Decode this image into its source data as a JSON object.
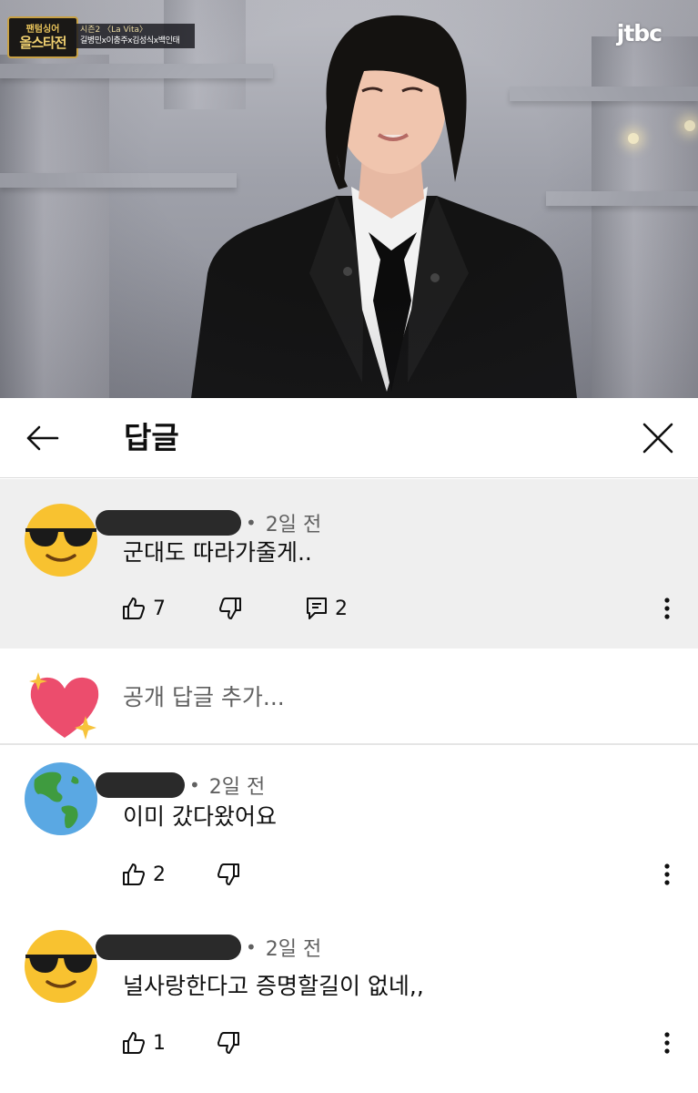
{
  "video": {
    "show_logo_line1": "팬텀싱어",
    "show_logo_line2": "올스타전",
    "season_label": "시즌2 〈La Vita〉",
    "cast_label": "길병민x이충주x김성식x백인태",
    "channel_logo": "jtbc"
  },
  "header": {
    "title": "답글",
    "back_icon": "arrow-left-icon",
    "close_icon": "close-icon"
  },
  "comments": [
    {
      "avatar": "sunglasses-emoji",
      "time": "2일 전",
      "text": "군대도 따라가줄게..",
      "likes": "7",
      "replies": "2"
    },
    {
      "avatar": "globe-americas-emoji",
      "time": "2일 전",
      "text": "이미 갔다왔어요",
      "likes": "2"
    },
    {
      "avatar": "sunglasses-emoji",
      "time": "2일 전",
      "text": "널사랑한다고 증명할길이 없네,,",
      "likes": "1"
    }
  ],
  "reply_box": {
    "avatar": "sparkling-heart-emoji",
    "placeholder": "공개 답글 추가..."
  },
  "colors": {
    "highlight_bg": "#efefef",
    "secondary_text": "#606060",
    "divider": "#dcdcdc"
  }
}
